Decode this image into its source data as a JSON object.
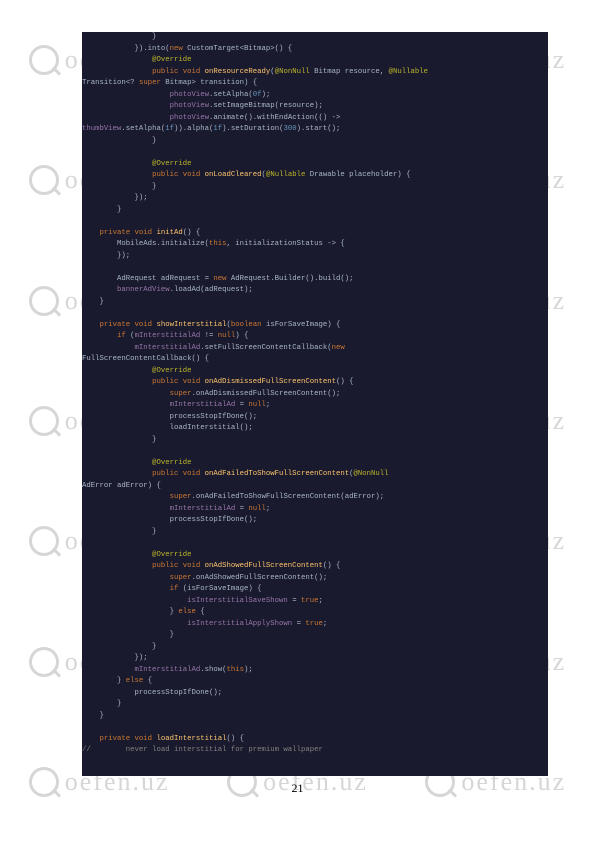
{
  "page_number": "21",
  "watermark_text": "oefen.uz",
  "code": {
    "l1": "                }",
    "l2a": "            }).into(",
    "l2b": "new",
    "l2c": " CustomTarget<Bitmap>() {",
    "l3": "                @Override",
    "l4a": "                ",
    "l4b": "public void ",
    "l4c": "onResourceReady",
    "l4d": "(",
    "l4e": "@NonNull ",
    "l4f": "Bitmap resource, ",
    "l4g": "@Nullable",
    "l5a": "Transition<? ",
    "l5b": "super ",
    "l5c": "Bitmap> transition) {",
    "l6a": "                    ",
    "l6b": "photoView",
    "l6c": ".setAlpha(",
    "l6d": "0f",
    "l6e": ");",
    "l7a": "                    ",
    "l7b": "photoView",
    "l7c": ".setImageBitmap(resource);",
    "l8a": "                    ",
    "l8b": "photoView",
    "l8c": ".animate().withEndAction(() ->",
    "l9a": "thumbView",
    "l9b": ".setAlpha(",
    "l9c": "1f",
    "l9d": ")).alpha(",
    "l9e": "1f",
    "l9f": ").setDuration(",
    "l9g": "300",
    "l9h": ").start();",
    "l10": "                }",
    "l11": "",
    "l12": "                @Override",
    "l13a": "                ",
    "l13b": "public void ",
    "l13c": "onLoadCleared",
    "l13d": "(",
    "l13e": "@Nullable ",
    "l13f": "Drawable placeholder) {",
    "l14": "                }",
    "l15": "            });",
    "l16": "        }",
    "l17": "",
    "l18a": "    ",
    "l18b": "private void ",
    "l18c": "initAd",
    "l18d": "() {",
    "l19a": "        MobileAds.initialize(",
    "l19b": "this",
    "l19c": ", initializationStatus -> {",
    "l20": "        });",
    "l21": "",
    "l22a": "        AdRequest adRequest = ",
    "l22b": "new ",
    "l22c": "AdRequest.Builder().build();",
    "l23a": "        ",
    "l23b": "bannerAdView",
    "l23c": ".loadAd(adRequest);",
    "l24": "    }",
    "l25": "",
    "l26a": "    ",
    "l26b": "private void ",
    "l26c": "showInterstitial",
    "l26d": "(",
    "l26e": "boolean ",
    "l26f": "isForSaveImage) {",
    "l27a": "        ",
    "l27b": "if ",
    "l27c": "(",
    "l27d": "mInterstitialAd ",
    "l27e": "!= ",
    "l27f": "null",
    "l27g": ") {",
    "l28a": "            ",
    "l28b": "mInterstitialAd",
    "l28c": ".setFullScreenContentCallback(",
    "l28d": "new",
    "l29": "FullScreenContentCallback() {",
    "l30": "                @Override",
    "l31a": "                ",
    "l31b": "public void ",
    "l31c": "onAdDismissedFullScreenContent",
    "l31d": "() {",
    "l32a": "                    ",
    "l32b": "super",
    "l32c": ".onAdDismissedFullScreenContent();",
    "l33a": "                    ",
    "l33b": "mInterstitialAd ",
    "l33c": "= ",
    "l33d": "null",
    "l33e": ";",
    "l34": "                    processStopIfDone();",
    "l35": "                    loadInterstitial();",
    "l36": "                }",
    "l37": "",
    "l38": "                @Override",
    "l39a": "                ",
    "l39b": "public void ",
    "l39c": "onAdFailedToShowFullScreenContent",
    "l39d": "(",
    "l39e": "@NonNull",
    "l40": "AdError adError) {",
    "l41a": "                    ",
    "l41b": "super",
    "l41c": ".onAdFailedToShowFullScreenContent(adError);",
    "l42a": "                    ",
    "l42b": "mInterstitialAd ",
    "l42c": "= ",
    "l42d": "null",
    "l42e": ";",
    "l43": "                    processStopIfDone();",
    "l44": "                }",
    "l45": "",
    "l46": "                @Override",
    "l47a": "                ",
    "l47b": "public void ",
    "l47c": "onAdShowedFullScreenContent",
    "l47d": "() {",
    "l48a": "                    ",
    "l48b": "super",
    "l48c": ".onAdShowedFullScreenContent();",
    "l49a": "                    ",
    "l49b": "if ",
    "l49c": "(isForSaveImage) {",
    "l50a": "                        ",
    "l50b": "isInterstitialSaveShown ",
    "l50c": "= ",
    "l50d": "true",
    "l50e": ";",
    "l51a": "                    } ",
    "l51b": "else ",
    "l51c": "{",
    "l52a": "                        ",
    "l52b": "isInterstitialApplyShown ",
    "l52c": "= ",
    "l52d": "true",
    "l52e": ";",
    "l53": "                    }",
    "l54": "                }",
    "l55": "            });",
    "l56a": "            ",
    "l56b": "mInterstitialAd",
    "l56c": ".show(",
    "l56d": "this",
    "l56e": ");",
    "l57a": "        } ",
    "l57b": "else ",
    "l57c": "{",
    "l58": "            processStopIfDone();",
    "l59": "        }",
    "l60": "    }",
    "l61": "",
    "l62a": "    ",
    "l62b": "private void ",
    "l62c": "loadInterstitial",
    "l62d": "() {",
    "l63": "//        never load interstitial for premium wallpaper"
  }
}
